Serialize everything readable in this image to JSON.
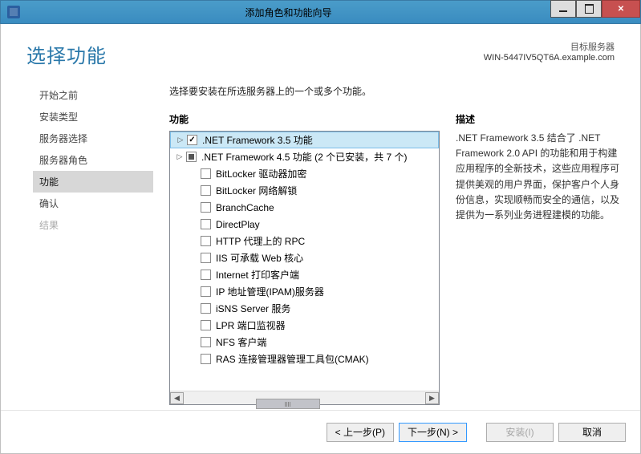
{
  "window": {
    "title": "添加角色和功能向导"
  },
  "header": {
    "title": "选择功能",
    "target_label": "目标服务器",
    "target_server": "WIN-5447IV5QT6A.example.com"
  },
  "nav": {
    "items": [
      {
        "label": "开始之前",
        "state": "normal"
      },
      {
        "label": "安装类型",
        "state": "normal"
      },
      {
        "label": "服务器选择",
        "state": "normal"
      },
      {
        "label": "服务器角色",
        "state": "normal"
      },
      {
        "label": "功能",
        "state": "selected"
      },
      {
        "label": "确认",
        "state": "normal"
      },
      {
        "label": "结果",
        "state": "disabled"
      }
    ]
  },
  "main": {
    "intro": "选择要安装在所选服务器上的一个或多个功能。",
    "features_header": "功能",
    "description_header": "描述",
    "description_text": ".NET Framework 3.5 结合了 .NET Framework 2.0 API 的功能和用于构建应用程序的全新技术，这些应用程序可提供美观的用户界面，保护客户个人身份信息，实现顺畅而安全的通信，以及提供为一系列业务进程建模的功能。",
    "features": [
      {
        "label": ".NET Framework 3.5 功能",
        "expandable": true,
        "checked": "checked",
        "selected": true,
        "indent": 0
      },
      {
        "label": ".NET Framework 4.5 功能 (2 个已安装，共 7 个)",
        "expandable": true,
        "checked": "partial",
        "indent": 0
      },
      {
        "label": "BitLocker 驱动器加密",
        "expandable": false,
        "checked": "none",
        "indent": 1
      },
      {
        "label": "BitLocker 网络解锁",
        "expandable": false,
        "checked": "none",
        "indent": 1
      },
      {
        "label": "BranchCache",
        "expandable": false,
        "checked": "none",
        "indent": 1
      },
      {
        "label": "DirectPlay",
        "expandable": false,
        "checked": "none",
        "indent": 1
      },
      {
        "label": "HTTP 代理上的 RPC",
        "expandable": false,
        "checked": "none",
        "indent": 1
      },
      {
        "label": "IIS 可承载 Web 核心",
        "expandable": false,
        "checked": "none",
        "indent": 1
      },
      {
        "label": "Internet 打印客户端",
        "expandable": false,
        "checked": "none",
        "indent": 1
      },
      {
        "label": "IP 地址管理(IPAM)服务器",
        "expandable": false,
        "checked": "none",
        "indent": 1
      },
      {
        "label": "iSNS Server 服务",
        "expandable": false,
        "checked": "none",
        "indent": 1
      },
      {
        "label": "LPR 端口监视器",
        "expandable": false,
        "checked": "none",
        "indent": 1
      },
      {
        "label": "NFS 客户端",
        "expandable": false,
        "checked": "none",
        "indent": 1
      },
      {
        "label": "RAS 连接管理器管理工具包(CMAK)",
        "expandable": false,
        "checked": "none",
        "indent": 1
      }
    ]
  },
  "footer": {
    "prev": "< 上一步(P)",
    "next": "下一步(N) >",
    "install": "安装(I)",
    "cancel": "取消"
  }
}
